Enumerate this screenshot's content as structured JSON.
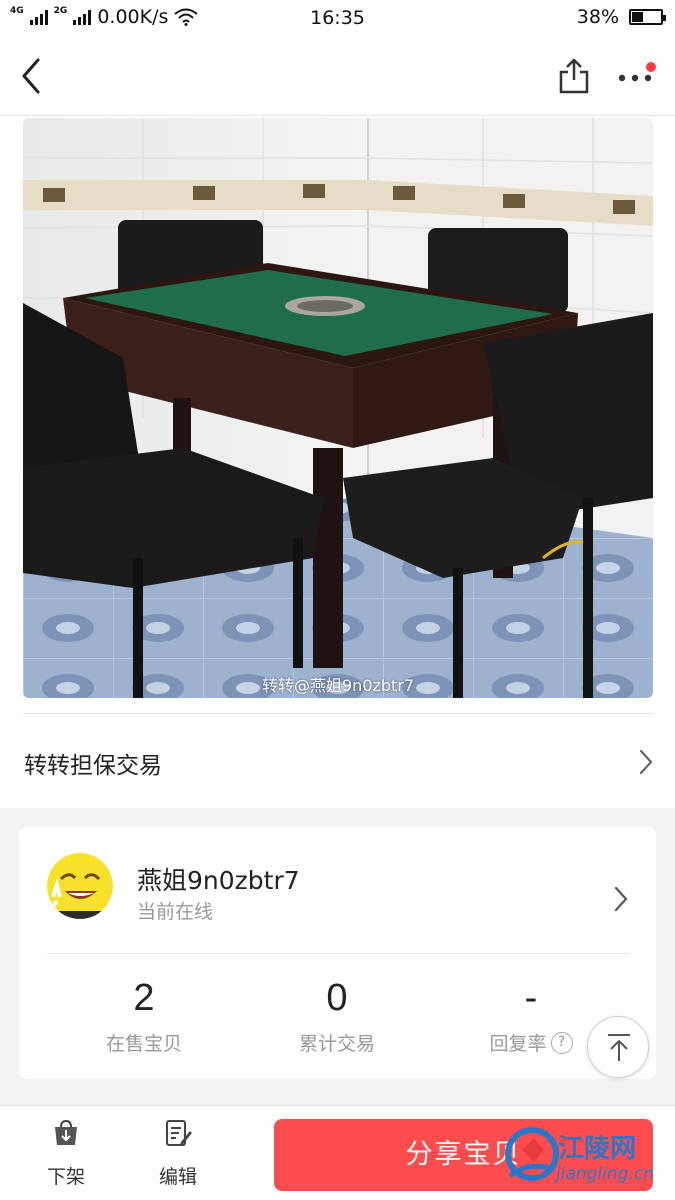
{
  "status_bar": {
    "net_labels": [
      "4G",
      "2G"
    ],
    "speed": "0.00K/s",
    "time": "16:35",
    "battery_percent_label": "38%",
    "battery_level": 0.38
  },
  "listing": {
    "image_watermark": "转转@燕姐9n0zbtr7",
    "guarantee_label": "转转担保交易"
  },
  "seller": {
    "name": "燕姐9n0zbtr7",
    "status": "当前在线",
    "stats": [
      {
        "value": "2",
        "label": "在售宝贝"
      },
      {
        "value": "0",
        "label": "累计交易"
      },
      {
        "value": "-",
        "label": "回复率"
      }
    ],
    "help_glyph": "?"
  },
  "bottom_bar": {
    "delist_label": "下架",
    "edit_label": "编辑",
    "share_button_label": "分享宝贝"
  },
  "site_logo": {
    "name_cn": "江陵网",
    "domain": "jiangling.cn"
  },
  "colors": {
    "accent": "#ff4c4f",
    "notification_dot": "#ff3b45",
    "logo_blue": "#2a77c9"
  }
}
